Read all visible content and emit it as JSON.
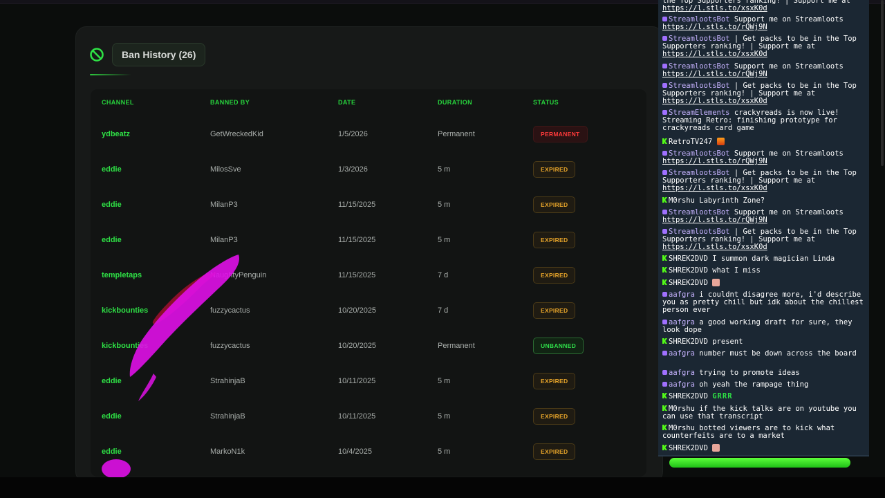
{
  "ban_history": {
    "title": "Ban History (26)",
    "columns": [
      "CHANNEL",
      "BANNED BY",
      "DATE",
      "DURATION",
      "STATUS"
    ],
    "rows": [
      {
        "channel": "ydbeatz",
        "banned_by": "GetWreckedKid",
        "date": "1/5/2026",
        "duration": "Permanent",
        "status": "PERMANENT",
        "status_type": "permanent"
      },
      {
        "channel": "eddie",
        "banned_by": "MilosSve",
        "date": "1/3/2026",
        "duration": "5 m",
        "status": "EXPIRED",
        "status_type": "expired"
      },
      {
        "channel": "eddie",
        "banned_by": "MilanP3",
        "date": "11/15/2025",
        "duration": "5 m",
        "status": "EXPIRED",
        "status_type": "expired"
      },
      {
        "channel": "eddie",
        "banned_by": "MilanP3",
        "date": "11/15/2025",
        "duration": "5 m",
        "status": "EXPIRED",
        "status_type": "expired"
      },
      {
        "channel": "templetaps",
        "banned_by": "NaughtyPenguin",
        "date": "11/15/2025",
        "duration": "7 d",
        "status": "EXPIRED",
        "status_type": "expired"
      },
      {
        "channel": "kickbounties",
        "banned_by": "fuzzycactus",
        "date": "10/20/2025",
        "duration": "7 d",
        "status": "EXPIRED",
        "status_type": "expired"
      },
      {
        "channel": "kickbounties",
        "banned_by": "fuzzycactus",
        "date": "10/20/2025",
        "duration": "Permanent",
        "status": "UNBANNED",
        "status_type": "unbanned"
      },
      {
        "channel": "eddie",
        "banned_by": "StrahinjaB",
        "date": "10/11/2025",
        "duration": "5 m",
        "status": "EXPIRED",
        "status_type": "expired"
      },
      {
        "channel": "eddie",
        "banned_by": "StrahinjaB",
        "date": "10/11/2025",
        "duration": "5 m",
        "status": "EXPIRED",
        "status_type": "expired"
      },
      {
        "channel": "eddie",
        "banned_by": "MarkoN1k",
        "date": "10/4/2025",
        "duration": "5 m",
        "status": "EXPIRED",
        "status_type": "expired"
      }
    ]
  },
  "colors": {
    "accent_green": "#2ee045",
    "expired": "#e8a52a",
    "permanent": "#ff3a3a",
    "unbanned": "#2fe04a",
    "chat_bg": "#1b2733",
    "scribble_magenta": "#e010e8",
    "scribble_red": "#c0102a"
  },
  "chat": {
    "messages": [
      {
        "platform": "twitch",
        "user": "",
        "segments": [
          "the Top Supporters ranking! | Support me at "
        ],
        "link": "https://l.stls.to/xsxK0d"
      },
      {
        "platform": "twitch",
        "user": "StreamlootsBot",
        "segments": [
          "Support me on Streamloots "
        ],
        "link": "https://l.stls.to/rQWj9N"
      },
      {
        "platform": "twitch",
        "user": "StreamlootsBot",
        "segments": [
          "| Get packs to be in the Top Supporters ranking! | Support me at "
        ],
        "link": "https://l.stls.to/xsxK0d"
      },
      {
        "platform": "twitch",
        "user": "StreamlootsBot",
        "segments": [
          "Support me on Streamloots "
        ],
        "link": "https://l.stls.to/rQWj9N"
      },
      {
        "platform": "twitch",
        "user": "StreamlootsBot",
        "segments": [
          "| Get packs to be in the Top Supporters ranking! | Support me at "
        ],
        "link": "https://l.stls.to/xsxK0d"
      },
      {
        "platform": "twitch",
        "user": "StreamElements",
        "segments": [
          "crackyreads is now live! Streaming Retro: finishing prototype for crackyreads card game"
        ],
        "link": ""
      },
      {
        "platform": "kick",
        "user": "RetroTV247",
        "segments": [
          ""
        ],
        "link": "",
        "emote": "fire"
      },
      {
        "platform": "twitch",
        "user": "StreamlootsBot",
        "segments": [
          "Support me on Streamloots "
        ],
        "link": "https://l.stls.to/rQWj9N"
      },
      {
        "platform": "twitch",
        "user": "StreamlootsBot",
        "segments": [
          "| Get packs to be in the Top Supporters ranking! | Support me at "
        ],
        "link": "https://l.stls.to/xsxK0d"
      },
      {
        "platform": "kick",
        "user": "M0rshu",
        "segments": [
          "Labyrinth Zone?"
        ],
        "link": ""
      },
      {
        "platform": "twitch",
        "user": "StreamlootsBot",
        "segments": [
          "Support me on Streamloots "
        ],
        "link": "https://l.stls.to/rQWj9N"
      },
      {
        "platform": "twitch",
        "user": "StreamlootsBot",
        "segments": [
          "| Get packs to be in the Top Supporters ranking! | Support me at "
        ],
        "link": "https://l.stls.to/xsxK0d"
      },
      {
        "platform": "kick",
        "user": "SHREK2DVD",
        "segments": [
          "I summon dark magician Linda"
        ],
        "link": ""
      },
      {
        "platform": "kick",
        "user": "SHREK2DVD",
        "segments": [
          "what I miss"
        ],
        "link": ""
      },
      {
        "platform": "kick",
        "user": "SHREK2DVD",
        "segments": [
          ""
        ],
        "link": "",
        "emote": "face"
      },
      {
        "platform": "twitch",
        "user": "aafgra",
        "segments": [
          "i couldnt disagree more, i'd describe you as pretty chill but idk about the chillest person ever"
        ],
        "link": ""
      },
      {
        "platform": "twitch",
        "user": "aafgra",
        "segments": [
          "a good working draft for sure, they look dope"
        ],
        "link": ""
      },
      {
        "platform": "kick",
        "user": "SHREK2DVD",
        "segments": [
          "present"
        ],
        "link": ""
      },
      {
        "platform": "twitch",
        "user": "aafgra",
        "segments": [
          "number must be down across the board"
        ],
        "link": ""
      },
      {
        "platform": "twitch",
        "user": "aafgra",
        "segments": [
          "trying to promote ideas"
        ],
        "link": ""
      },
      {
        "platform": "twitch",
        "user": "aafgra",
        "segments": [
          "oh yeah the rampage thing"
        ],
        "link": ""
      },
      {
        "platform": "kick",
        "user": "SHREK2DVD",
        "segments": [
          ""
        ],
        "link": "",
        "grrr": "GRRR"
      },
      {
        "platform": "kick",
        "user": "M0rshu",
        "segments": [
          "if the kick talks are on youtube you can use that transcript"
        ],
        "link": ""
      },
      {
        "platform": "kick",
        "user": "M0rshu",
        "segments": [
          "botted viewers are to kick what counterfeits are to a market"
        ],
        "link": ""
      },
      {
        "platform": "kick",
        "user": "SHREK2DVD",
        "segments": [
          ""
        ],
        "link": "",
        "emote": "face"
      }
    ]
  }
}
